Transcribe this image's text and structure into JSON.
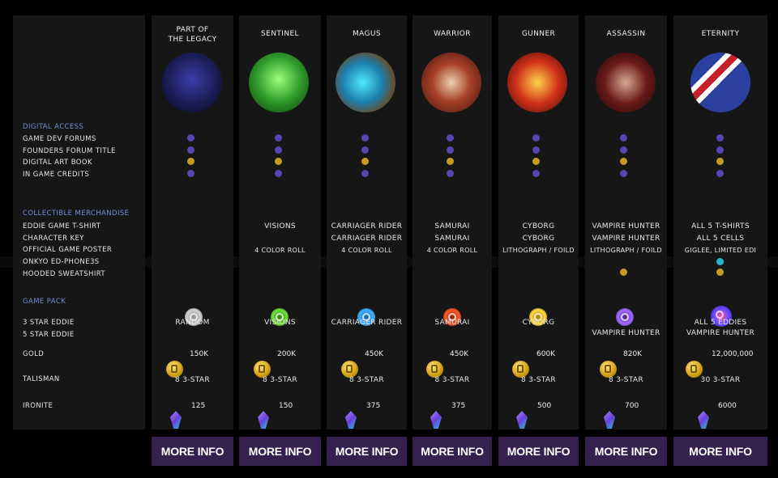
{
  "rows": {
    "digital_access": "DIGITAL ACCESS",
    "game_dev_forums": "GAME DEV FORUMS",
    "founders_forum_title": "FOUNDERS FORUM TITLE",
    "digital_art_book": "DIGITAL ART BOOK",
    "in_game_credits": "IN GAME CREDITS",
    "collectible_merchandise": "COLLECTIBLE MERCHANDISE",
    "eddie_game_tshirt": "EDDIE GAME T-SHIRT",
    "character_key": "CHARACTER KEY",
    "official_game_poster": "OFFICIAL GAME POSTER",
    "onkyo": "ONKYO ED-PHONE3S",
    "hooded_sweatshirt": "HOODED SWEATSHIRT",
    "game_pack": "GAME PACK",
    "three_star_eddie": "3 STAR EDDIE",
    "five_star_eddie": "5 STAR EDDIE",
    "gold": "GOLD",
    "talisman": "TALISMAN",
    "ironite": "IRONITE"
  },
  "colors": {
    "purple_dot": "#5a44b0",
    "gold_dot": "#c99a22",
    "cyan_dot": "#22b7c8",
    "button": "#35204f",
    "section_label": "#6f8fd8"
  },
  "tiers": [
    {
      "title_line1": "PART OF",
      "title_line2": "THE LEGACY",
      "tshirt": "",
      "key": "",
      "poster": "",
      "three_star": "RANDOM",
      "five_star": "",
      "gold": "150K",
      "talisman": "8 3-STAR",
      "ironite": "125",
      "button": "MORE INFO"
    },
    {
      "title_line1": "SENTINEL",
      "title_line2": "",
      "tshirt": "VISIONS",
      "key": "",
      "poster": "4 COLOR ROLL",
      "three_star": "VISIONS",
      "five_star": "",
      "gold": "200K",
      "talisman": "8 3-STAR",
      "ironite": "150",
      "button": "MORE INFO"
    },
    {
      "title_line1": "MAGUS",
      "title_line2": "",
      "tshirt": "CARRIAGER RIDER",
      "key": "CARRIAGER RIDER",
      "poster": "4 COLOR ROLL",
      "three_star": "CARRIAGER RIDER",
      "five_star": "",
      "gold": "450K",
      "talisman": "8 3-STAR",
      "ironite": "375",
      "button": "MORE INFO"
    },
    {
      "title_line1": "WARRIOR",
      "title_line2": "",
      "tshirt": "SAMURAI",
      "key": "SAMURAI",
      "poster": "4 COLOR ROLL",
      "three_star": "SAMURAI",
      "five_star": "",
      "gold": "450K",
      "talisman": "8 3-STAR",
      "ironite": "375",
      "button": "MORE INFO"
    },
    {
      "title_line1": "GUNNER",
      "title_line2": "",
      "tshirt": "CYBORG",
      "key": "CYBORG",
      "poster": "LITHOGRAPH / FOILD",
      "three_star": "CYBORG",
      "five_star": "",
      "gold": "600K",
      "talisman": "8 3-STAR",
      "ironite": "500",
      "button": "MORE INFO"
    },
    {
      "title_line1": "ASSASSIN",
      "title_line2": "",
      "tshirt": "VAMPIRE HUNTER",
      "key": "VAMPIRE HUNTER",
      "poster": "LITHOGRAPH / FOILD",
      "three_star": "",
      "five_star": "VAMPIRE HUNTER",
      "gold": "820K",
      "talisman": "8 3-STAR",
      "ironite": "700",
      "button": "MORE INFO"
    },
    {
      "title_line1": "ETERNITY",
      "title_line2": "",
      "tshirt": "ALL 5 T-SHIRTS",
      "key": "ALL 5 CELLS",
      "poster": "GIGLEE, LIMITED EDI",
      "three_star": "ALL 5 EDDIES",
      "five_star": "VAMPIRE HUNTER",
      "gold": "12,000,000",
      "talisman": "30 3-STAR",
      "ironite": "6000",
      "button": "MORE INFO"
    }
  ]
}
